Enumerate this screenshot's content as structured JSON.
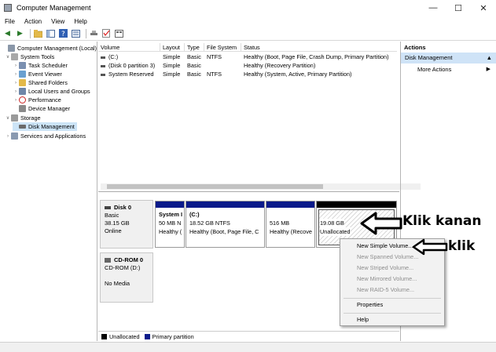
{
  "window": {
    "title": "Computer Management",
    "controls": [
      "minimize-icon",
      "maximize-icon",
      "close-icon"
    ]
  },
  "menu": [
    "File",
    "Action",
    "View",
    "Help"
  ],
  "tree": {
    "root": "Computer Management (Local)",
    "system_tools": "System Tools",
    "items": [
      "Task Scheduler",
      "Event Viewer",
      "Shared Folders",
      "Local Users and Groups",
      "Performance",
      "Device Manager"
    ],
    "storage": "Storage",
    "disk_management": "Disk Management",
    "services": "Services and Applications"
  },
  "volumes": {
    "columns": [
      "Volume",
      "Layout",
      "Type",
      "File System",
      "Status"
    ],
    "rows": [
      {
        "volume": "(C:)",
        "layout": "Simple",
        "type": "Basic",
        "fs": "NTFS",
        "status": "Healthy (Boot, Page File, Crash Dump, Primary Partition)"
      },
      {
        "volume": "(Disk 0 partition 3)",
        "layout": "Simple",
        "type": "Basic",
        "fs": "",
        "status": "Healthy (Recovery Partition)"
      },
      {
        "volume": "System Reserved",
        "layout": "Simple",
        "type": "Basic",
        "fs": "NTFS",
        "status": "Healthy (System, Active, Primary Partition)"
      }
    ]
  },
  "disk0": {
    "name": "Disk 0",
    "type": "Basic",
    "size": "38.15 GB",
    "state": "Online",
    "partitions": [
      {
        "name": "System I",
        "size": "50 MB N",
        "status": "Healthy ("
      },
      {
        "name": "(C:)",
        "size": "18.52 GB NTFS",
        "status": "Healthy (Boot, Page File, C"
      },
      {
        "name": "",
        "size": "516 MB",
        "status": "Healthy (Recove"
      },
      {
        "name": "",
        "size": "19.08 GB",
        "status": "Unallocated"
      }
    ]
  },
  "cdrom": {
    "name": "CD-ROM 0",
    "drive": "CD-ROM (D:)",
    "media": "No Media"
  },
  "legend": {
    "unallocated": "Unallocated",
    "primary": "Primary partition",
    "unallocated_color": "#000000",
    "primary_color": "#0a1a8a"
  },
  "actions": {
    "header": "Actions",
    "selected": "Disk Management",
    "more": "More Actions"
  },
  "context_menu": {
    "new_simple": "New Simple Volume...",
    "new_spanned": "New Spanned Volume...",
    "new_striped": "New Striped Volume...",
    "new_mirrored": "New Mirrored Volume...",
    "new_raid5": "New RAID-5 Volume...",
    "properties": "Properties",
    "help": "Help"
  },
  "annotations": {
    "right_click": "Klik kanan",
    "click": "klik"
  }
}
